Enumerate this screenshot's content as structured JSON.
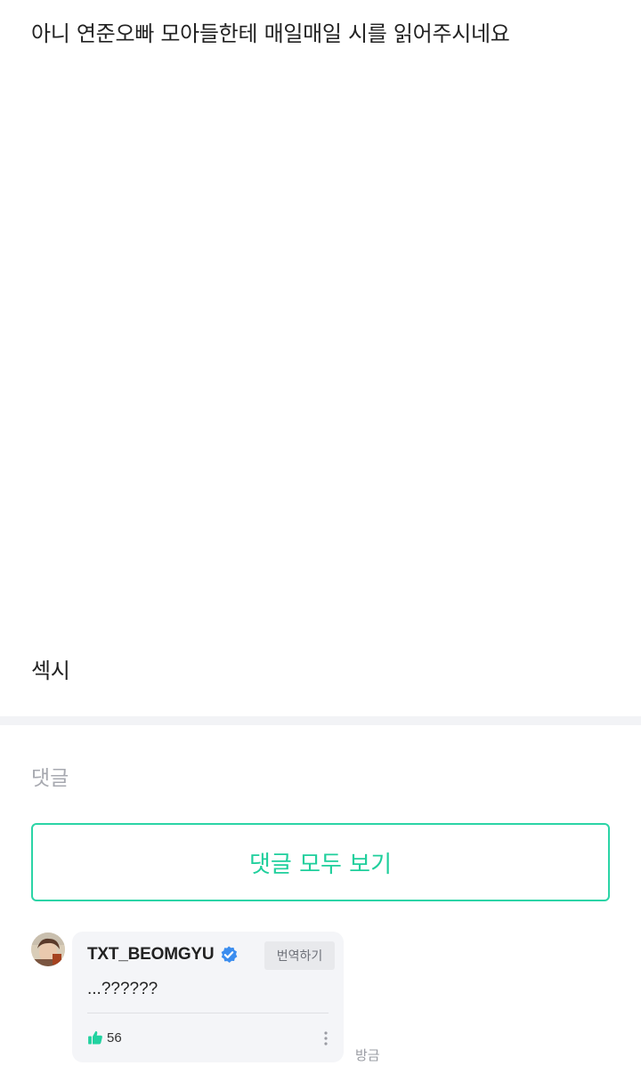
{
  "post": {
    "line1": "아니 연준오빠 모아들한테 매일매일 시를 읽어주시네요",
    "line2": "섹시"
  },
  "comments_section": {
    "heading": "댓글",
    "view_all_label": "댓글 모두 보기"
  },
  "comment": {
    "author": "TXT_BEOMGYU",
    "verified": true,
    "translate_label": "번역하기",
    "body": "...??????",
    "likes": "56",
    "timestamp": "방금",
    "icons": {
      "avatar": "avatar",
      "verified": "verified-badge-icon",
      "like": "thumbs-up-icon",
      "more": "more-vertical-icon"
    }
  },
  "colors": {
    "accent": "#1fcf9c",
    "verified_blue": "#3b8def",
    "like_green": "#21d2a0"
  }
}
